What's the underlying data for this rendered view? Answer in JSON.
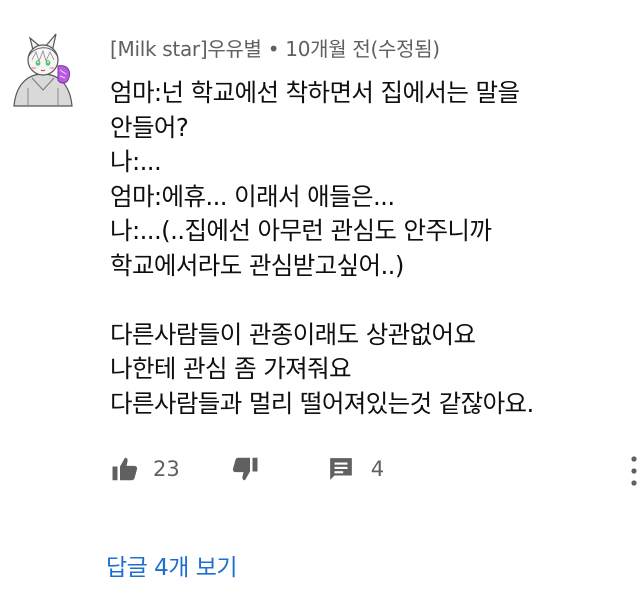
{
  "comment": {
    "author": "[Milk star]우유별",
    "separator": "•",
    "time": "10개월 전(수정됨)",
    "lines": [
      "엄마:넌 학교에선 착하면서 집에서는 말을",
      "안들어?",
      "나:...",
      "엄마:에휴... 이래서 애들은...",
      "나:...(..집에선 아무런 관심도 안주니까",
      "학교에서라도 관심받고싶어..)",
      "",
      "다른사람들이 관종이래도 상관없어요",
      "나한테 관심 좀 가져줘요",
      "다른사람들과 멀리 떨어져있는것 같잖아요."
    ],
    "likes": "23",
    "replies_count": "4",
    "view_replies": "답글 4개 보기"
  },
  "icons": {
    "avatar": "anime-cat-avatar",
    "like": "thumbs-up-icon",
    "dislike": "thumbs-down-icon",
    "reply": "reply-comment-icon",
    "more": "more-vertical-icon"
  },
  "colors": {
    "text": "#0f0f0f",
    "meta": "#606060",
    "link": "#1e6fd0"
  }
}
